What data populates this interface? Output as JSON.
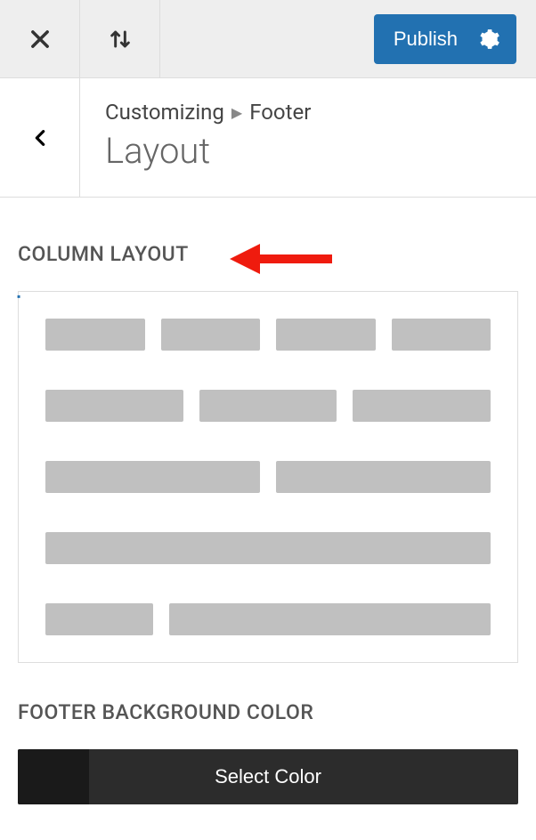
{
  "topbar": {
    "publish_label": "Publish"
  },
  "header": {
    "breadcrumb_root": "Customizing",
    "breadcrumb_current": "Footer",
    "title": "Layout"
  },
  "sections": {
    "column_layout": {
      "label": "Column Layout"
    },
    "footer_background": {
      "label": "Footer Background Color",
      "button_label": "Select Color"
    }
  }
}
